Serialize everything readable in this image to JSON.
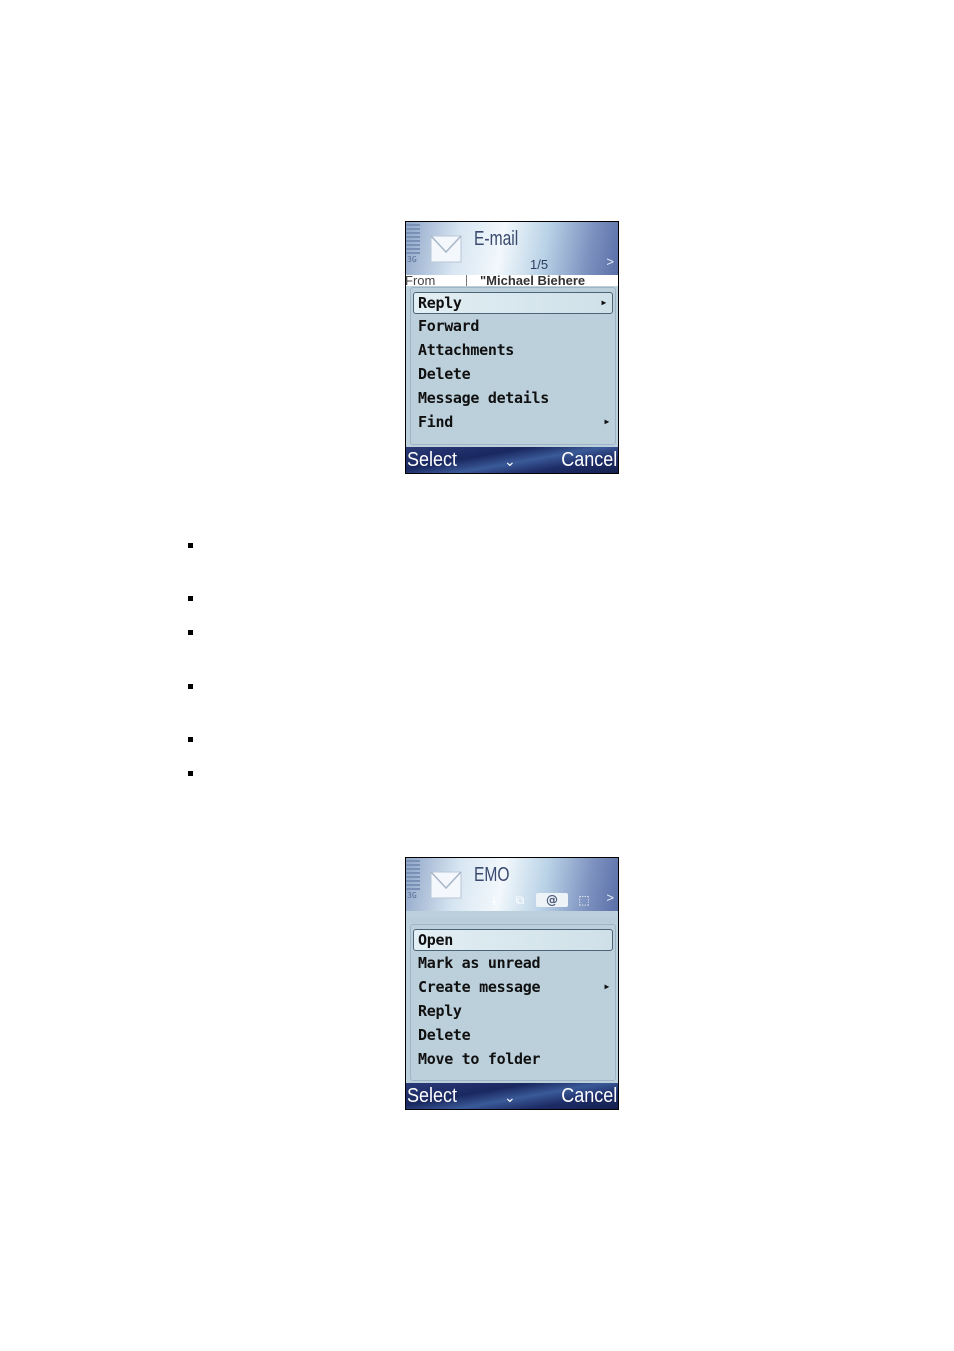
{
  "screens": [
    {
      "header": {
        "title": "E-mail",
        "counter": "1/5",
        "nav_right": ">",
        "network_label": "3G",
        "icon": "envelope-icon"
      },
      "from_row": {
        "label": "From",
        "value": "\"Michael Biehere"
      },
      "menu": {
        "items": [
          {
            "label": "Reply",
            "submenu": true,
            "highlighted": true
          },
          {
            "label": "Forward",
            "submenu": false
          },
          {
            "label": "Attachments",
            "submenu": false
          },
          {
            "label": "Delete",
            "submenu": false
          },
          {
            "label": "Message details",
            "submenu": false
          },
          {
            "label": "Find",
            "submenu": true
          }
        ]
      },
      "softkeys": {
        "left": "Select",
        "middle": "⌄",
        "right": "Cancel"
      }
    },
    {
      "header": {
        "title": "EMO",
        "nav_left": "<",
        "nav_right": ">",
        "network_label": "3G",
        "icon": "envelope-icon",
        "tabs": [
          {
            "icon": "download-icon",
            "glyph": "⤓",
            "active": false
          },
          {
            "icon": "folder-icon",
            "glyph": "⧉",
            "active": false
          },
          {
            "icon": "at-sign-icon",
            "glyph": "@",
            "active": true
          },
          {
            "icon": "dashed-box-icon",
            "glyph": "⬚",
            "active": false
          }
        ]
      },
      "menu": {
        "items": [
          {
            "label": "Open",
            "submenu": false,
            "highlighted": true
          },
          {
            "label": "Mark as unread",
            "submenu": false
          },
          {
            "label": "Create message",
            "submenu": true
          },
          {
            "label": "Reply",
            "submenu": false
          },
          {
            "label": "Delete",
            "submenu": false
          },
          {
            "label": "Move to folder",
            "submenu": false
          }
        ]
      },
      "softkeys": {
        "left": "Select",
        "middle": "⌄",
        "right": "Cancel"
      }
    }
  ],
  "bullet_list": {
    "count": 6,
    "items": [
      "",
      "",
      "",
      "",
      "",
      ""
    ]
  },
  "colors": {
    "menu_bg": "#bcd0dc",
    "highlight_border": "#4d6478",
    "softkey_bg": "#1a2860",
    "softkey_text": "#ffffff"
  }
}
